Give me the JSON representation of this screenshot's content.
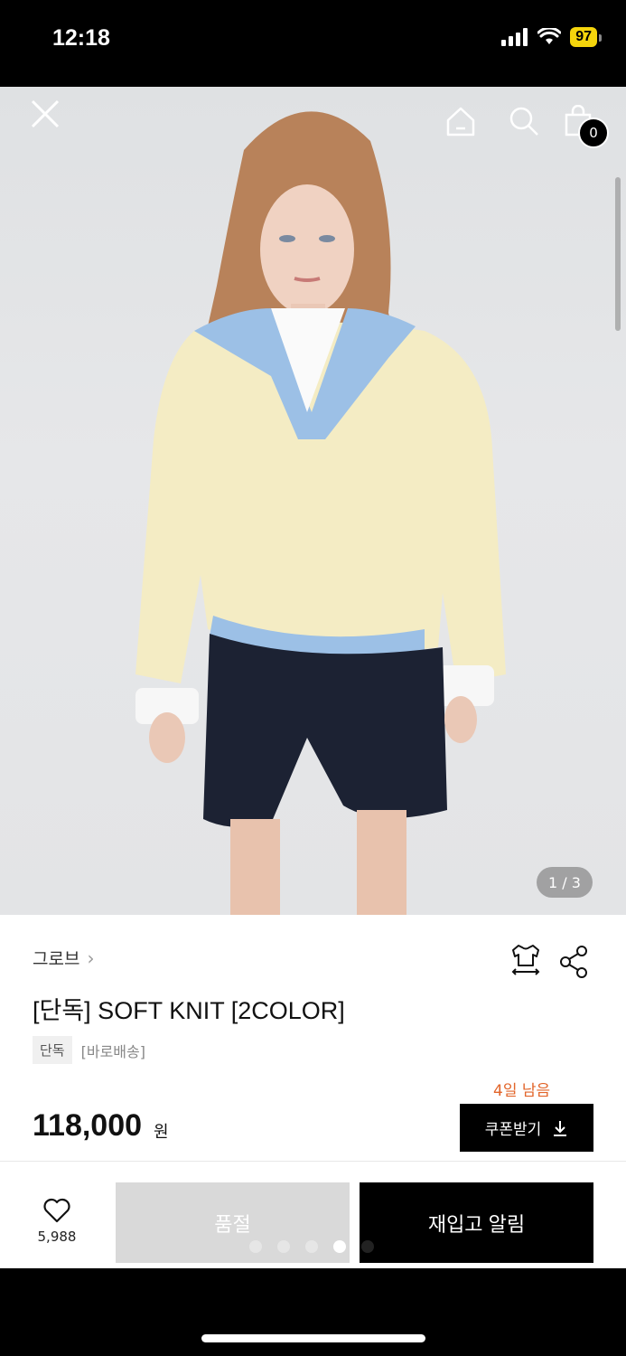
{
  "status_bar": {
    "time": "12:18",
    "battery": "97"
  },
  "hero": {
    "page_counter": "1 / 3",
    "cart_count": "0"
  },
  "product": {
    "brand": "그로브",
    "title": "[단독] SOFT KNIT [2COLOR]",
    "tags": [
      "단독",
      "[바로배송]"
    ],
    "price": "118,000",
    "price_unit": "원",
    "coupon_remaining": "4일 남음",
    "coupon_button": "쿠폰받기"
  },
  "bottom_bar": {
    "wish_count": "5,988",
    "soldout_label": "품절",
    "restock_label": "재입고 알림"
  },
  "colors": {
    "accent": "#e2652a",
    "primary": "#000000",
    "disabled": "#d9d9d9"
  },
  "icons": [
    "close-icon",
    "home-icon",
    "search-icon",
    "shopping-bag-icon",
    "size-guide-icon",
    "share-icon",
    "heart-icon",
    "download-icon"
  ]
}
